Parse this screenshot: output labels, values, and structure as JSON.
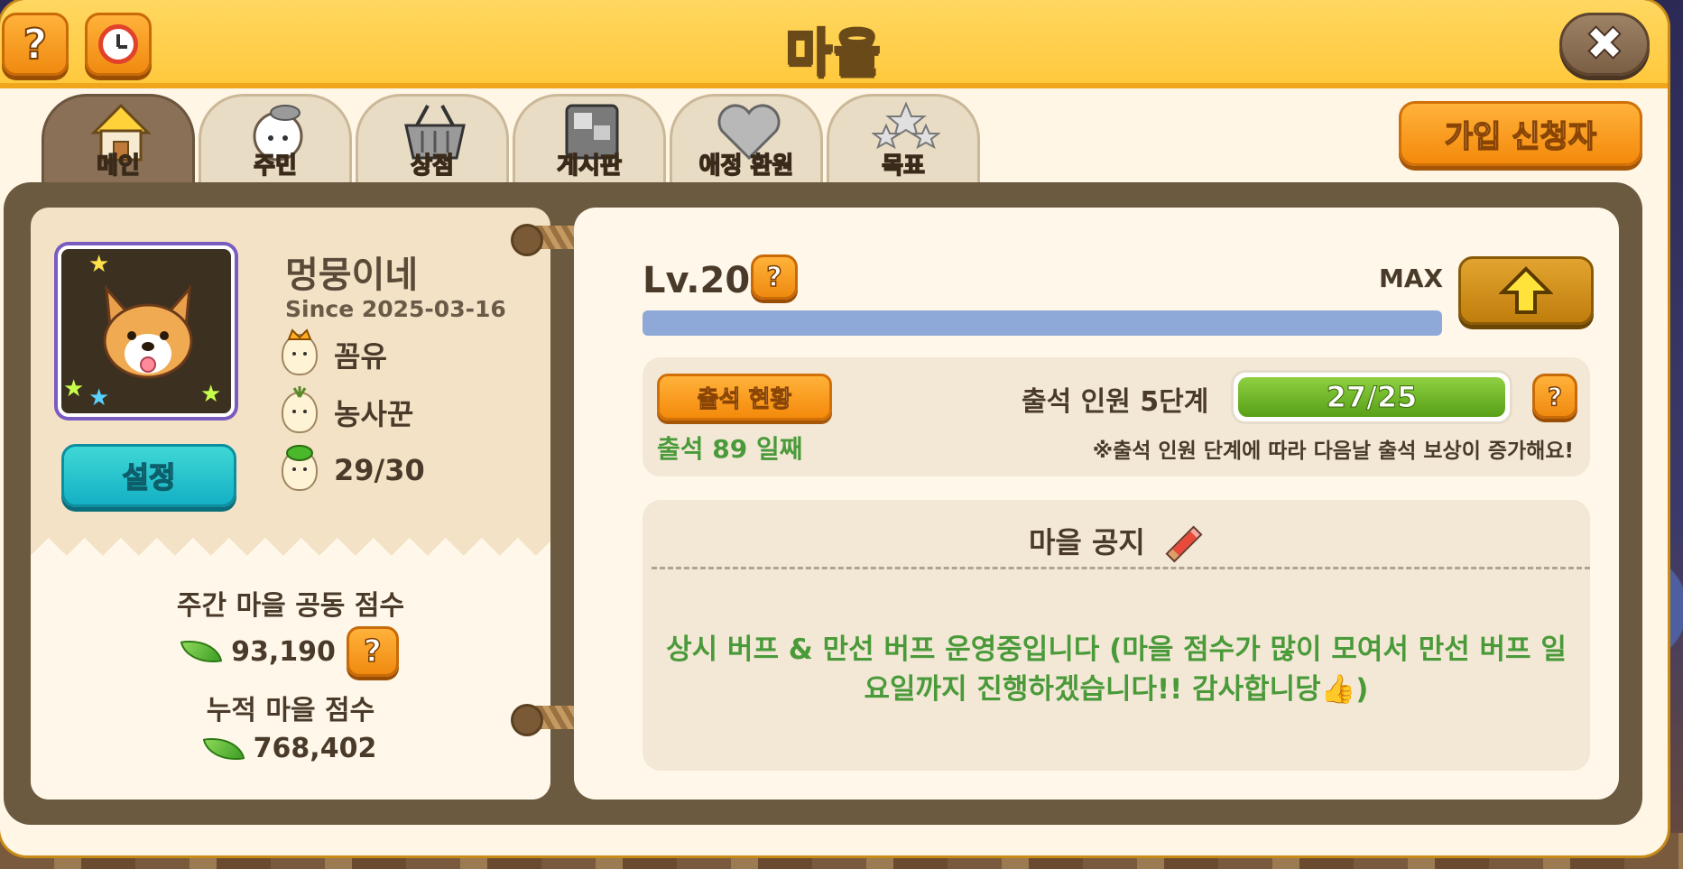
{
  "window": {
    "title": "마을",
    "help_label": "?",
    "close_label": "✖",
    "apply_button": "가입 신청자"
  },
  "tabs": [
    {
      "label": "메인",
      "icon": "house-icon",
      "active": true
    },
    {
      "label": "주민",
      "icon": "resident-icon",
      "active": false
    },
    {
      "label": "상점",
      "icon": "basket-icon",
      "active": false
    },
    {
      "label": "게시판",
      "icon": "board-icon",
      "active": false
    },
    {
      "label": "애정 환원",
      "icon": "heart-icon",
      "active": false
    },
    {
      "label": "목표",
      "icon": "stars-icon",
      "active": false
    }
  ],
  "profile": {
    "name": "멍뭉이네",
    "since": "Since 2025-03-16",
    "leader": "꼼유",
    "sub_leader": "농사꾼",
    "members": "29/30",
    "settings_button": "설정"
  },
  "scores": {
    "weekly_title": "주간 마을 공동 점수",
    "weekly_value": "93,190",
    "total_title": "누적 마을 점수",
    "total_value": "768,402",
    "help_label": "?"
  },
  "level": {
    "label": "Lv.20",
    "max_label": "MAX",
    "progress": 1.0,
    "help_label": "?"
  },
  "attendance": {
    "button": "출석 현황",
    "days": "출석 89 일째",
    "stage_label": "출석 인원 5단계",
    "progress_text": "27/25",
    "note": "※출석 인원 단계에 따라 다음날 출석 보상이 증가해요!",
    "help_label": "?"
  },
  "notice": {
    "title": "마을 공지",
    "text": "상시 버프 & 만선 버프 운영중입니다 (마을 점수가 많이 모여서 만선 버프 일요일까지 진행하겠습니다!! 감사합니당👍)"
  },
  "colors": {
    "title_bar": "#ffc93d",
    "frame": "#6b5a40",
    "accent_orange": "#f48a0c",
    "accent_teal": "#14b0c4",
    "green_text": "#4a9a3a",
    "level_bar": "#8ea9d8",
    "attend_bar": "#58a018"
  }
}
